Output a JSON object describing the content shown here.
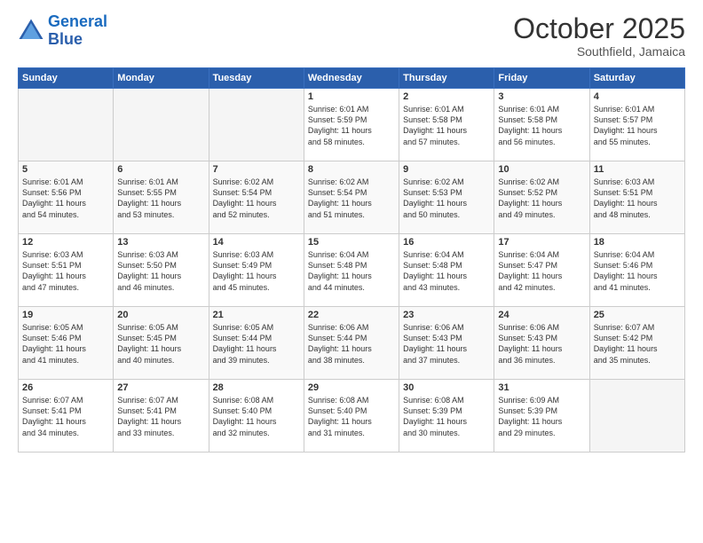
{
  "header": {
    "logo_line1": "General",
    "logo_line2": "Blue",
    "month": "October 2025",
    "location": "Southfield, Jamaica"
  },
  "weekdays": [
    "Sunday",
    "Monday",
    "Tuesday",
    "Wednesday",
    "Thursday",
    "Friday",
    "Saturday"
  ],
  "weeks": [
    [
      {
        "day": "",
        "info": ""
      },
      {
        "day": "",
        "info": ""
      },
      {
        "day": "",
        "info": ""
      },
      {
        "day": "1",
        "info": "Sunrise: 6:01 AM\nSunset: 5:59 PM\nDaylight: 11 hours\nand 58 minutes."
      },
      {
        "day": "2",
        "info": "Sunrise: 6:01 AM\nSunset: 5:58 PM\nDaylight: 11 hours\nand 57 minutes."
      },
      {
        "day": "3",
        "info": "Sunrise: 6:01 AM\nSunset: 5:58 PM\nDaylight: 11 hours\nand 56 minutes."
      },
      {
        "day": "4",
        "info": "Sunrise: 6:01 AM\nSunset: 5:57 PM\nDaylight: 11 hours\nand 55 minutes."
      }
    ],
    [
      {
        "day": "5",
        "info": "Sunrise: 6:01 AM\nSunset: 5:56 PM\nDaylight: 11 hours\nand 54 minutes."
      },
      {
        "day": "6",
        "info": "Sunrise: 6:01 AM\nSunset: 5:55 PM\nDaylight: 11 hours\nand 53 minutes."
      },
      {
        "day": "7",
        "info": "Sunrise: 6:02 AM\nSunset: 5:54 PM\nDaylight: 11 hours\nand 52 minutes."
      },
      {
        "day": "8",
        "info": "Sunrise: 6:02 AM\nSunset: 5:54 PM\nDaylight: 11 hours\nand 51 minutes."
      },
      {
        "day": "9",
        "info": "Sunrise: 6:02 AM\nSunset: 5:53 PM\nDaylight: 11 hours\nand 50 minutes."
      },
      {
        "day": "10",
        "info": "Sunrise: 6:02 AM\nSunset: 5:52 PM\nDaylight: 11 hours\nand 49 minutes."
      },
      {
        "day": "11",
        "info": "Sunrise: 6:03 AM\nSunset: 5:51 PM\nDaylight: 11 hours\nand 48 minutes."
      }
    ],
    [
      {
        "day": "12",
        "info": "Sunrise: 6:03 AM\nSunset: 5:51 PM\nDaylight: 11 hours\nand 47 minutes."
      },
      {
        "day": "13",
        "info": "Sunrise: 6:03 AM\nSunset: 5:50 PM\nDaylight: 11 hours\nand 46 minutes."
      },
      {
        "day": "14",
        "info": "Sunrise: 6:03 AM\nSunset: 5:49 PM\nDaylight: 11 hours\nand 45 minutes."
      },
      {
        "day": "15",
        "info": "Sunrise: 6:04 AM\nSunset: 5:48 PM\nDaylight: 11 hours\nand 44 minutes."
      },
      {
        "day": "16",
        "info": "Sunrise: 6:04 AM\nSunset: 5:48 PM\nDaylight: 11 hours\nand 43 minutes."
      },
      {
        "day": "17",
        "info": "Sunrise: 6:04 AM\nSunset: 5:47 PM\nDaylight: 11 hours\nand 42 minutes."
      },
      {
        "day": "18",
        "info": "Sunrise: 6:04 AM\nSunset: 5:46 PM\nDaylight: 11 hours\nand 41 minutes."
      }
    ],
    [
      {
        "day": "19",
        "info": "Sunrise: 6:05 AM\nSunset: 5:46 PM\nDaylight: 11 hours\nand 41 minutes."
      },
      {
        "day": "20",
        "info": "Sunrise: 6:05 AM\nSunset: 5:45 PM\nDaylight: 11 hours\nand 40 minutes."
      },
      {
        "day": "21",
        "info": "Sunrise: 6:05 AM\nSunset: 5:44 PM\nDaylight: 11 hours\nand 39 minutes."
      },
      {
        "day": "22",
        "info": "Sunrise: 6:06 AM\nSunset: 5:44 PM\nDaylight: 11 hours\nand 38 minutes."
      },
      {
        "day": "23",
        "info": "Sunrise: 6:06 AM\nSunset: 5:43 PM\nDaylight: 11 hours\nand 37 minutes."
      },
      {
        "day": "24",
        "info": "Sunrise: 6:06 AM\nSunset: 5:43 PM\nDaylight: 11 hours\nand 36 minutes."
      },
      {
        "day": "25",
        "info": "Sunrise: 6:07 AM\nSunset: 5:42 PM\nDaylight: 11 hours\nand 35 minutes."
      }
    ],
    [
      {
        "day": "26",
        "info": "Sunrise: 6:07 AM\nSunset: 5:41 PM\nDaylight: 11 hours\nand 34 minutes."
      },
      {
        "day": "27",
        "info": "Sunrise: 6:07 AM\nSunset: 5:41 PM\nDaylight: 11 hours\nand 33 minutes."
      },
      {
        "day": "28",
        "info": "Sunrise: 6:08 AM\nSunset: 5:40 PM\nDaylight: 11 hours\nand 32 minutes."
      },
      {
        "day": "29",
        "info": "Sunrise: 6:08 AM\nSunset: 5:40 PM\nDaylight: 11 hours\nand 31 minutes."
      },
      {
        "day": "30",
        "info": "Sunrise: 6:08 AM\nSunset: 5:39 PM\nDaylight: 11 hours\nand 30 minutes."
      },
      {
        "day": "31",
        "info": "Sunrise: 6:09 AM\nSunset: 5:39 PM\nDaylight: 11 hours\nand 29 minutes."
      },
      {
        "day": "",
        "info": ""
      }
    ]
  ]
}
